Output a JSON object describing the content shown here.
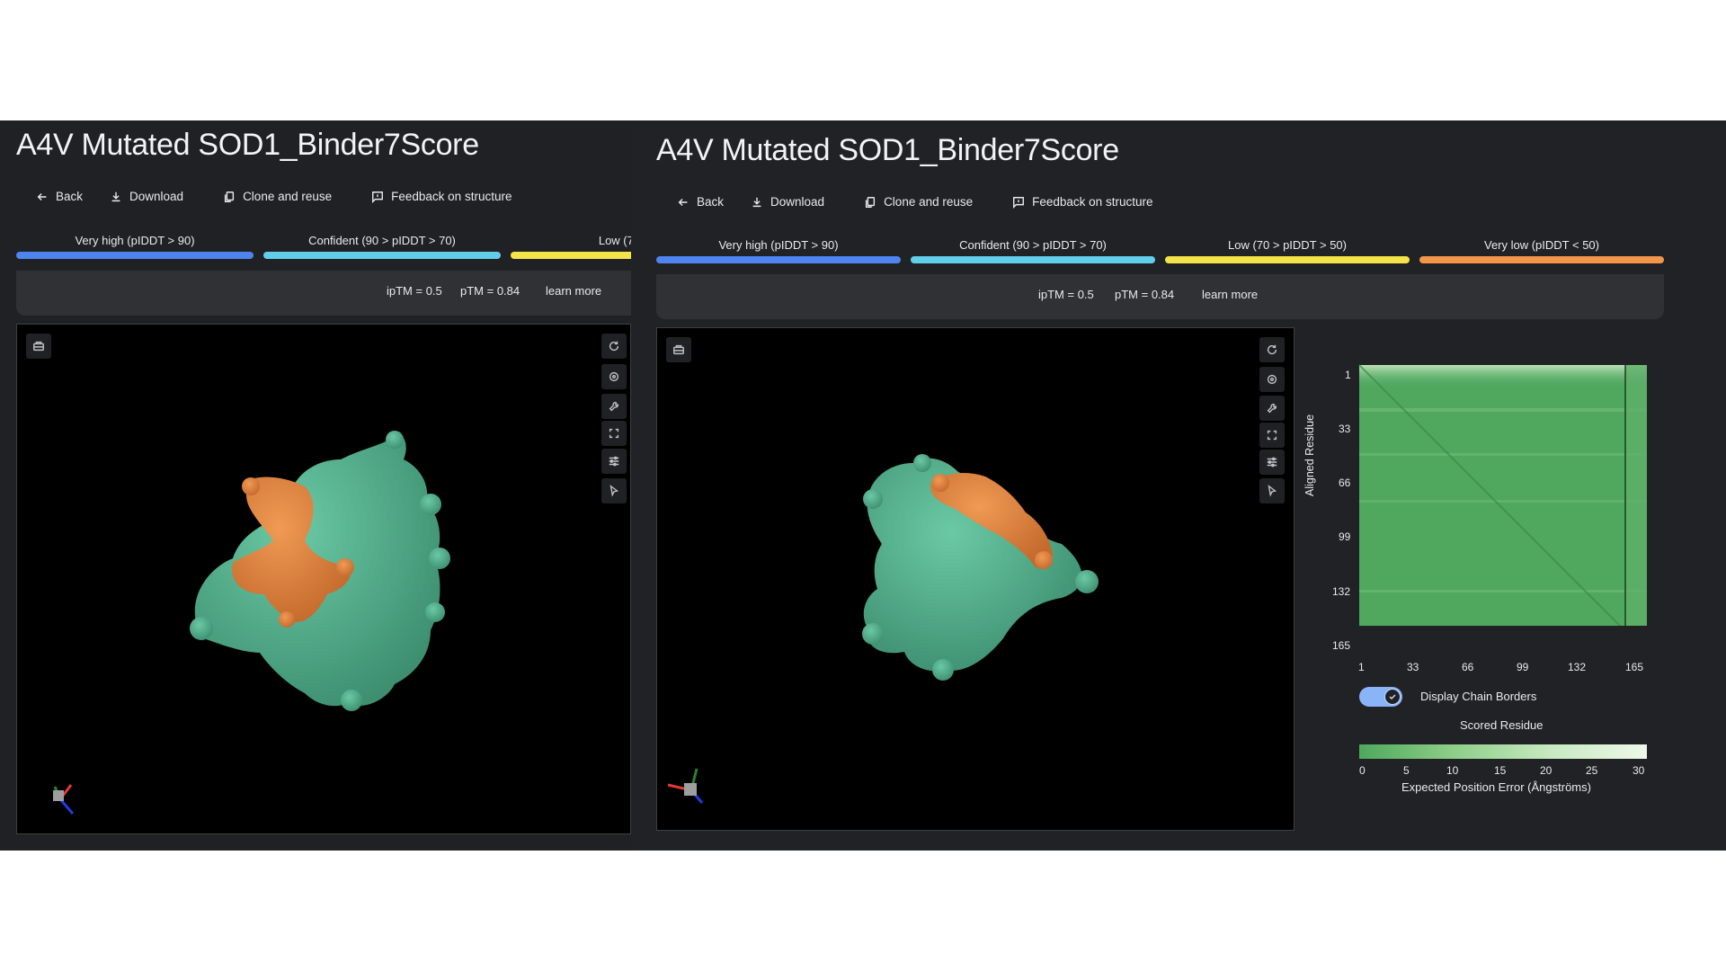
{
  "title": "A4V Mutated SOD1_Binder7Score",
  "actions": {
    "back": "Back",
    "download": "Download",
    "clone": "Clone and reuse",
    "feedback": "Feedback on structure"
  },
  "legend": [
    {
      "label": "Very high (pIDDT > 90)",
      "color": "#4e84f0"
    },
    {
      "label": "Confident (90 > pIDDT > 70)",
      "color": "#62cfea"
    },
    {
      "label": "Low (70 > pIDDT > 50)",
      "color": "#f5e34a"
    },
    {
      "label": "Very low (pIDDT < 50)",
      "color": "#f3964a"
    }
  ],
  "left_legend_truncated": "Low (70 > p",
  "scores": {
    "iptm": "ipTM = 0.5",
    "ptm": "pTM = 0.84",
    "learn_more": "learn more"
  },
  "colors": {
    "protein": "#52b08e",
    "binder": "#e08440",
    "pae_low": "#4fa85e",
    "pae_high": "#eef8ea"
  },
  "icons": {
    "viewer_top_left": "screenshot-icon",
    "viewer_tools": [
      "rotate-icon",
      "center-icon",
      "wrench-icon",
      "fullscreen-icon",
      "sliders-icon",
      "pointer-icon"
    ],
    "axes": "axes-gizmo-icon"
  },
  "pae": {
    "y_label": "Aligned Residue",
    "x_label": "Scored Residue",
    "ticks": [
      "1",
      "33",
      "66",
      "99",
      "132",
      "165"
    ],
    "chain_toggle_label": "Display Chain Borders",
    "chain_toggle_on": true,
    "colorbar_ticks": [
      "0",
      "5",
      "10",
      "15",
      "20",
      "25",
      "30"
    ],
    "colorbar_label": "Expected Position Error (Ångströms)"
  }
}
